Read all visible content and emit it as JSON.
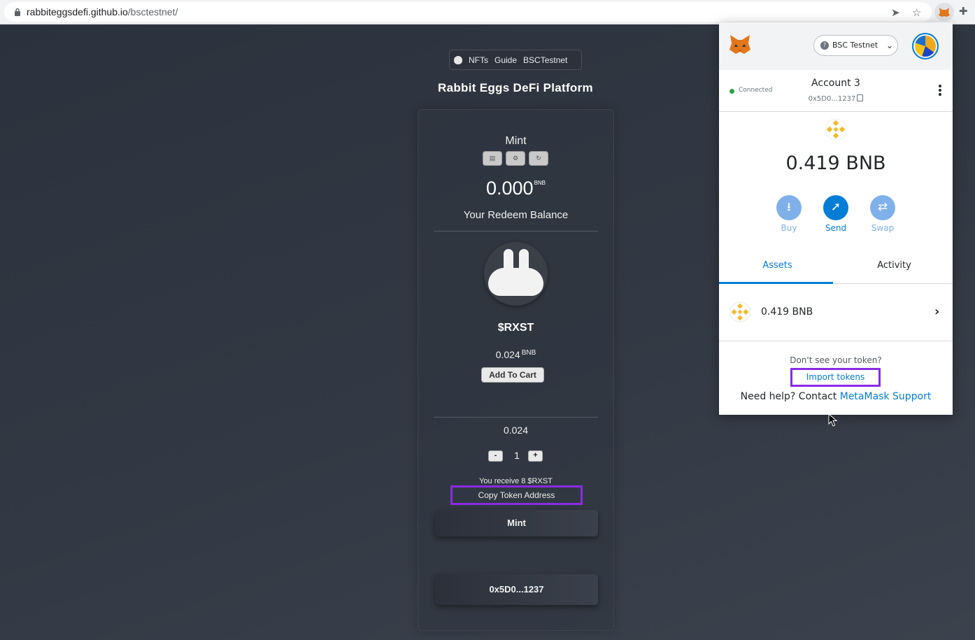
{
  "browser": {
    "url_domain": "rabbiteggsdefi.github.io",
    "url_path": "/bsctestnet/",
    "icons": [
      "lock-icon",
      "send-icon",
      "star-icon",
      "metamask-extension-icon",
      "puzzle-icon"
    ]
  },
  "site": {
    "nav": {
      "nft": "NFTs",
      "guide": "Guide",
      "network": "BSCTestnet"
    },
    "title": "Rabbit Eggs DeFi Platform",
    "mint_heading": "Mint",
    "balance_value": "0.000",
    "balance_unit": "BNB",
    "redeem_label": "Your Redeem Balance",
    "token_name": "$RXST",
    "price_value": "0.024",
    "price_unit": "BNB",
    "add_to_cart": "Add To Cart",
    "total": "0.024",
    "decrement": "-",
    "quantity": "1",
    "increment": "+",
    "receive_text": "You receive 8 $RXST",
    "copy_address": "Copy Token Address",
    "mint_button": "Mint",
    "wallet_button": "0x5D0...1237"
  },
  "metamask": {
    "network": "BSC Testnet",
    "network_badge": "?",
    "connected": "Connected",
    "account_name": "Account 3",
    "account_address": "0x5D0...1237",
    "balance": "0.419 BNB",
    "actions": [
      {
        "label": "Buy",
        "glyph": "⭳",
        "color": "#7fb0ea",
        "text_color": "#7fb0ea"
      },
      {
        "label": "Send",
        "glyph": "➚",
        "color": "#037dd6",
        "text_color": "#037dd6"
      },
      {
        "label": "Swap",
        "glyph": "⇄",
        "color": "#7fb0ea",
        "text_color": "#7fb0ea"
      }
    ],
    "tabs": {
      "assets": "Assets",
      "activity": "Activity"
    },
    "asset": {
      "amount": "0.419 BNB"
    },
    "dont_see": "Don't see your token?",
    "import_tokens": "Import tokens",
    "help_prefix": "Need help? Contact",
    "help_link": "MetaMask Support"
  },
  "colors": {
    "highlight": "#8a2be2",
    "metamask_blue": "#037dd6",
    "bnb_yellow": "#f3ba2f"
  }
}
